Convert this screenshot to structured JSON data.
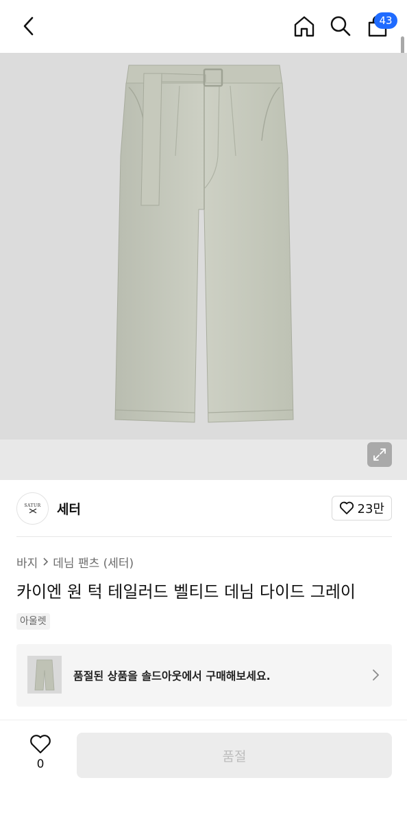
{
  "header": {
    "cart_count": "43"
  },
  "brand": {
    "logo_text": "SATUR",
    "name": "세터",
    "likes": "23만"
  },
  "breadcrumb": {
    "items": [
      "바지",
      "데님 팬츠 (세터)"
    ]
  },
  "product": {
    "title": "카이엔 원 턱 테일러드 벨티드 데님 다이드 그레이",
    "tag": "아울렛"
  },
  "soldout_banner": {
    "text": "품절된 상품을 솔드아웃에서 구매해보세요."
  },
  "bottom": {
    "wish_count": "0",
    "buy_label": "품절"
  },
  "colors": {
    "badge": "#1f6bff",
    "product_denim": "#c9ccc0",
    "hero_bg": "#dcdcdc"
  }
}
